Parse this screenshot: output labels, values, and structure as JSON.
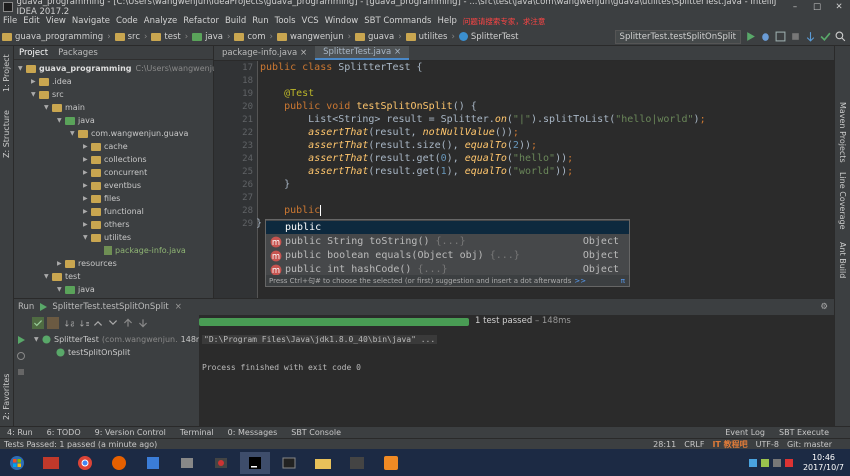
{
  "window": {
    "title": "guava_programming - [C:\\Users\\wangwenjun\\IdeaProjects\\guava_programming] - [guava_programming] - ...\\src\\test\\java\\com\\wangwenjun\\guava\\utilites\\SplitterTest.java - IntelliJ IDEA 2017.2"
  },
  "menu": {
    "items": [
      "File",
      "Edit",
      "View",
      "Navigate",
      "Code",
      "Analyze",
      "Refactor",
      "Build",
      "Run",
      "Tools",
      "VCS",
      "Window",
      "SBT Commands",
      "Help"
    ],
    "hint": "问题请搜索专家，求注意"
  },
  "breadcrumb": [
    "guava_programming",
    "src",
    "test",
    "java",
    "com",
    "wangwenjun",
    "guava",
    "utilites",
    "SplitterTest"
  ],
  "run_config": {
    "selected": "SplitterTest.testSplitOnSplit"
  },
  "project_panel": {
    "tabs": [
      "Project",
      "Packages"
    ],
    "tree": [
      {
        "label": "guava_programming",
        "path": "C:\\Users\\wangwenjun\\Ide",
        "indent": 0,
        "open": true,
        "bold": true
      },
      {
        "label": ".idea",
        "indent": 1,
        "open": false
      },
      {
        "label": "src",
        "indent": 1,
        "open": true
      },
      {
        "label": "main",
        "indent": 2,
        "open": true
      },
      {
        "label": "java",
        "indent": 3,
        "open": true
      },
      {
        "label": "com.wangwenjun.guava",
        "indent": 4,
        "open": true
      },
      {
        "label": "cache",
        "indent": 5
      },
      {
        "label": "collections",
        "indent": 5
      },
      {
        "label": "concurrent",
        "indent": 5
      },
      {
        "label": "eventbus",
        "indent": 5
      },
      {
        "label": "files",
        "indent": 5
      },
      {
        "label": "functional",
        "indent": 5
      },
      {
        "label": "others",
        "indent": 5
      },
      {
        "label": "utilites",
        "indent": 5,
        "open": true
      },
      {
        "label": "package-info.java",
        "indent": 6,
        "file": true
      },
      {
        "label": "resources",
        "indent": 3
      },
      {
        "label": "test",
        "indent": 2,
        "open": true
      },
      {
        "label": "java",
        "indent": 3,
        "open": true
      }
    ]
  },
  "editor": {
    "tabs": [
      "package-info.java",
      "SplitterTest.java"
    ],
    "active_tab": "SplitterTest.java",
    "line_numbers": [
      "17",
      "18",
      "19",
      "20",
      "21",
      "22",
      "23",
      "24",
      "25",
      "26",
      "27",
      "28",
      "29"
    ]
  },
  "completion": {
    "items": [
      {
        "name": "public",
        "sig": "",
        "type": "",
        "selected": true
      },
      {
        "name": "public String toString()",
        "sig": "{...}",
        "type": "Object"
      },
      {
        "name": "public boolean equals(Object obj)",
        "sig": "{...}",
        "type": "Object"
      },
      {
        "name": "public int hashCode()",
        "sig": "{...}",
        "type": "Object"
      }
    ],
    "footer": "Press Ctrl+句# to choose the selected (or first) suggestion and insert a dot afterwards",
    "footer_link": ">>",
    "pi": "π"
  },
  "run_panel": {
    "tab": "Run",
    "config": "SplitterTest.testSplitOnSplit",
    "status": "1 test passed",
    "duration": "– 148ms",
    "progress": 1.0,
    "tree": [
      {
        "label": "SplitterTest",
        "detail": "(com.wangwenjun.",
        "time": "148ms"
      },
      {
        "label": "testSplitOnSplit",
        "detail": "",
        "time": ""
      }
    ],
    "console": [
      "\"D:\\Program Files\\Java\\jdk1.8.0_40\\bin\\java\" ...",
      "Process finished with exit code 0"
    ]
  },
  "tool_windows": [
    "4: Run",
    "6: TODO",
    "9: Version Control",
    "Terminal",
    "0: Messages",
    "SBT Console"
  ],
  "right_tools": [
    "Event Log",
    "SBT Execute"
  ],
  "status_bar": {
    "message": "Tests Passed: 1 passed (a minute ago)",
    "position": "28:11",
    "line_sep": "CRLF",
    "encoding": "UTF-8",
    "git": "Git: master",
    "watermark": "IT 教程吧"
  },
  "right_strip": [
    "Maven Projects",
    "Line Coverage",
    "Ant Build"
  ],
  "left_strip": [
    "1: Project",
    "Z: Structure",
    "2: Favorites"
  ],
  "clock": {
    "time": "10:46",
    "date": "2017/10/7"
  },
  "colors": {
    "accent": "#4a88c7",
    "progress": "#499c54",
    "bg": "#2b2b2b",
    "panel": "#3c3f41"
  }
}
